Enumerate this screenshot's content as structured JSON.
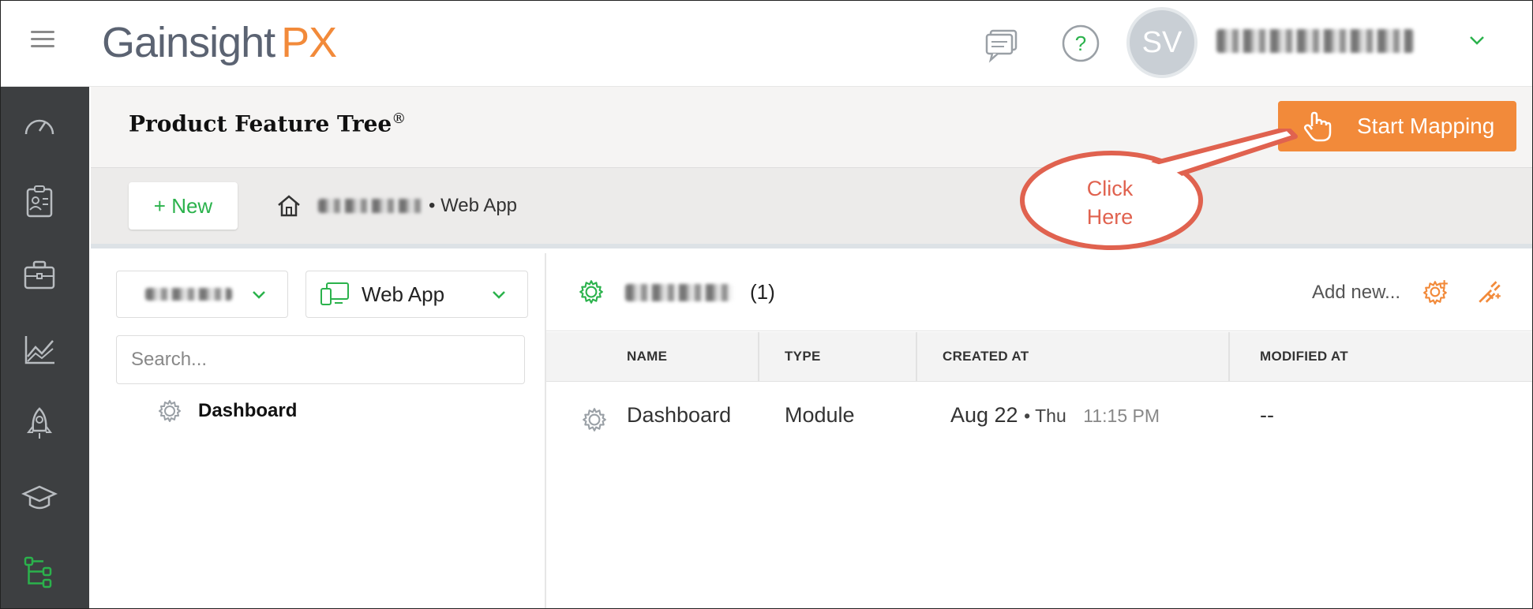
{
  "app": {
    "logo_main": "Gainsight",
    "logo_accent": "PX"
  },
  "user": {
    "initials": "SV"
  },
  "header": {
    "title": "Product Feature Tree",
    "title_mark": "®",
    "start_mapping_label": "Start Mapping"
  },
  "toolbar": {
    "new_label": "+ New",
    "breadcrumb_suffix": "• Web App"
  },
  "callout": {
    "line1": "Click",
    "line2": "Here"
  },
  "left_panel": {
    "product_select_value": "",
    "app_select_value": "Web App",
    "search_placeholder": "Search...",
    "tree_items": [
      {
        "label": "Dashboard"
      }
    ]
  },
  "main": {
    "count": "(1)",
    "add_new_label": "Add new...",
    "columns": [
      "NAME",
      "TYPE",
      "CREATED AT",
      "MODIFIED AT"
    ],
    "rows": [
      {
        "name": "Dashboard",
        "type": "Module",
        "created_date": "Aug 22",
        "created_day": "• Thu",
        "created_time": "11:15 PM",
        "modified": "--"
      }
    ]
  },
  "colors": {
    "accent_orange": "#f28a3a",
    "green": "#2bb24c",
    "sidebar": "#3d3f41",
    "callout": "#e0624f"
  },
  "icons": [
    "hamburger-icon",
    "chat-icon",
    "help-icon",
    "chevron-down-icon",
    "dashboard-gauge-icon",
    "people-icon",
    "briefcase-icon",
    "analytics-icon",
    "rocket-icon",
    "graduation-cap-icon",
    "feature-tree-icon",
    "hand-pointer-icon",
    "home-icon",
    "web-app-icon",
    "module-gear-icon",
    "add-module-icon",
    "add-feature-icon"
  ]
}
